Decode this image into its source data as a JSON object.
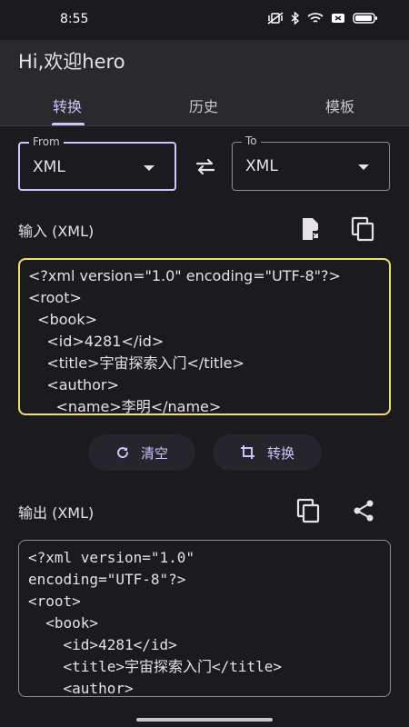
{
  "status": {
    "time": "8:55"
  },
  "app": {
    "title": "Hi,欢迎hero"
  },
  "tabs": [
    {
      "label": "转换",
      "active": true
    },
    {
      "label": "历史",
      "active": false
    },
    {
      "label": "模板",
      "active": false
    }
  ],
  "from": {
    "label": "From",
    "value": "XML"
  },
  "to": {
    "label": "To",
    "value": "XML"
  },
  "input": {
    "title": "输入 (XML)",
    "lines": [
      "<?xml version=\"1.0\" encoding=\"UTF-8\"?>",
      "<root>",
      "  <book>",
      "    <id>4281</id>",
      "    <title>宇宙探索入门</title>",
      "    <author>",
      "      <name>李明</name>"
    ]
  },
  "actions": {
    "clear": "清空",
    "convert": "转换"
  },
  "output": {
    "title": "输出 (XML)",
    "lines": [
      "<?xml version=\"1.0\"",
      "encoding=\"UTF-8\"?>",
      "<root>",
      "  <book>",
      "    <id>4281</id>",
      "    <title>宇宙探索入门</title>",
      "    <author>"
    ]
  },
  "icons": {
    "swap": "swap-icon",
    "paste": "paste-icon",
    "copy": "copy-icon",
    "share": "share-icon",
    "refresh": "refresh-icon",
    "transform": "crop-rotate-icon"
  },
  "colors": {
    "accent": "#cfc2ff",
    "input_border": "#f2dc6a",
    "background": "#1b1b1f",
    "surface": "#29292e"
  }
}
